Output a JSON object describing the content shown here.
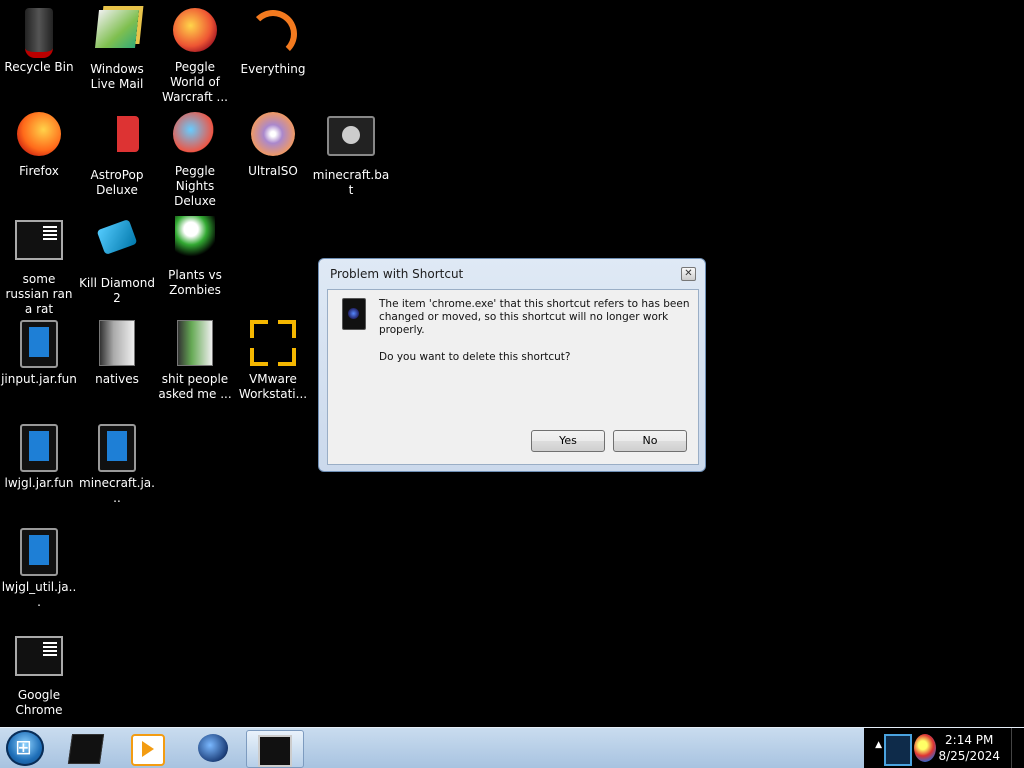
{
  "desktop": {
    "icons": [
      {
        "label": "Recycle Bin",
        "icon": "recycle-bin-icon"
      },
      {
        "label": "Windows Live Mail",
        "icon": "windows-live-mail-icon"
      },
      {
        "label": "Peggle World of Warcraft ...",
        "icon": "peggle-icon"
      },
      {
        "label": "Everything",
        "icon": "everything-icon"
      },
      {
        "label": "Firefox",
        "icon": "firefox-icon"
      },
      {
        "label": "AstroPop Deluxe",
        "icon": "astropop-icon"
      },
      {
        "label": "Peggle Nights Deluxe",
        "icon": "peggle-nights-icon"
      },
      {
        "label": "UltraISO",
        "icon": "ultraiso-icon"
      },
      {
        "label": "minecraft.bat",
        "icon": "batch-file-icon"
      },
      {
        "label": "some russian ran a rat",
        "icon": "shortcut-icon"
      },
      {
        "label": "Kill Diamond 2",
        "icon": "kill-diamond-icon"
      },
      {
        "label": "Plants vs Zombies",
        "icon": "plants-vs-zombies-icon"
      },
      {
        "label": "jinput.jar.fun",
        "icon": "java-file-icon"
      },
      {
        "label": "natives",
        "icon": "folder-icon"
      },
      {
        "label": "shit people asked me ...",
        "icon": "folder-icon"
      },
      {
        "label": "VMware Workstati...",
        "icon": "vmware-icon"
      },
      {
        "label": "lwjgl.jar.fun",
        "icon": "java-file-icon"
      },
      {
        "label": "minecraft.ja...",
        "icon": "java-file-icon"
      },
      {
        "label": "lwjgl_util.ja...",
        "icon": "java-file-icon"
      },
      {
        "label": "Google Chrome",
        "icon": "shortcut-icon"
      }
    ]
  },
  "dialog": {
    "title": "Problem with Shortcut",
    "message": "The item 'chrome.exe' that this shortcut refers to has been changed or moved, so this shortcut will no longer work properly.",
    "question": "Do you want to delete this shortcut?",
    "yes_label": "Yes",
    "no_label": "No",
    "close_glyph": "✕"
  },
  "taskbar": {
    "pinned": [
      {
        "icon": "command-window-icon"
      },
      {
        "icon": "media-player-icon"
      },
      {
        "icon": "globe-icon"
      },
      {
        "icon": "terminal-icon",
        "active": true
      }
    ],
    "tray_arrow": "▲",
    "clock_time": "2:14 PM",
    "clock_date": "8/25/2024"
  }
}
